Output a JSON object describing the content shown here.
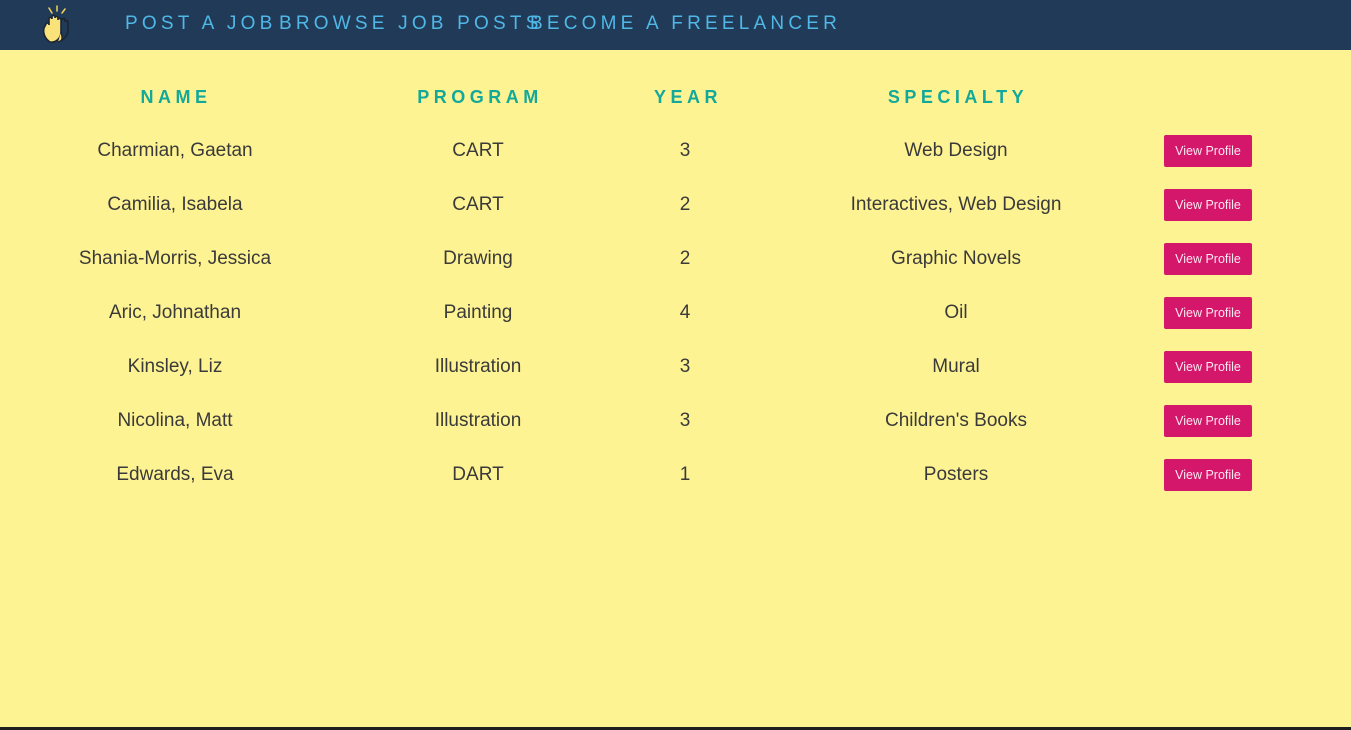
{
  "nav": {
    "logo_icon": "waving-hands-icon",
    "links": [
      "POST A JOB",
      "BROWSE JOB POSTS",
      "BECOME A FREELANCER"
    ]
  },
  "table": {
    "headers": [
      "NAME",
      "PROGRAM",
      "YEAR",
      "SPECIALTY"
    ],
    "rows": [
      {
        "name": "Charmian, Gaetan",
        "program": "CART",
        "year": "3",
        "specialty": "Web Design",
        "action": "View Profile"
      },
      {
        "name": "Camilia, Isabela",
        "program": "CART",
        "year": "2",
        "specialty": "Interactives, Web Design",
        "action": "View Profile"
      },
      {
        "name": "Shania-Morris, Jessica",
        "program": "Drawing",
        "year": "2",
        "specialty": "Graphic Novels",
        "action": "View Profile"
      },
      {
        "name": "Aric, Johnathan",
        "program": "Painting",
        "year": "4",
        "specialty": "Oil",
        "action": "View Profile"
      },
      {
        "name": "Kinsley, Liz",
        "program": "Illustration",
        "year": "3",
        "specialty": "Mural",
        "action": "View Profile"
      },
      {
        "name": "Nicolina, Matt",
        "program": "Illustration",
        "year": "3",
        "specialty": "Children's Books",
        "action": "View Profile"
      },
      {
        "name": "Edwards, Eva",
        "program": "DART",
        "year": "1",
        "specialty": "Posters",
        "action": "View Profile"
      }
    ]
  },
  "colors": {
    "background": "#fef392",
    "navbar": "#213a58",
    "nav_link": "#4fb8e6",
    "header_text": "#12a99a",
    "button": "#d4176b"
  }
}
